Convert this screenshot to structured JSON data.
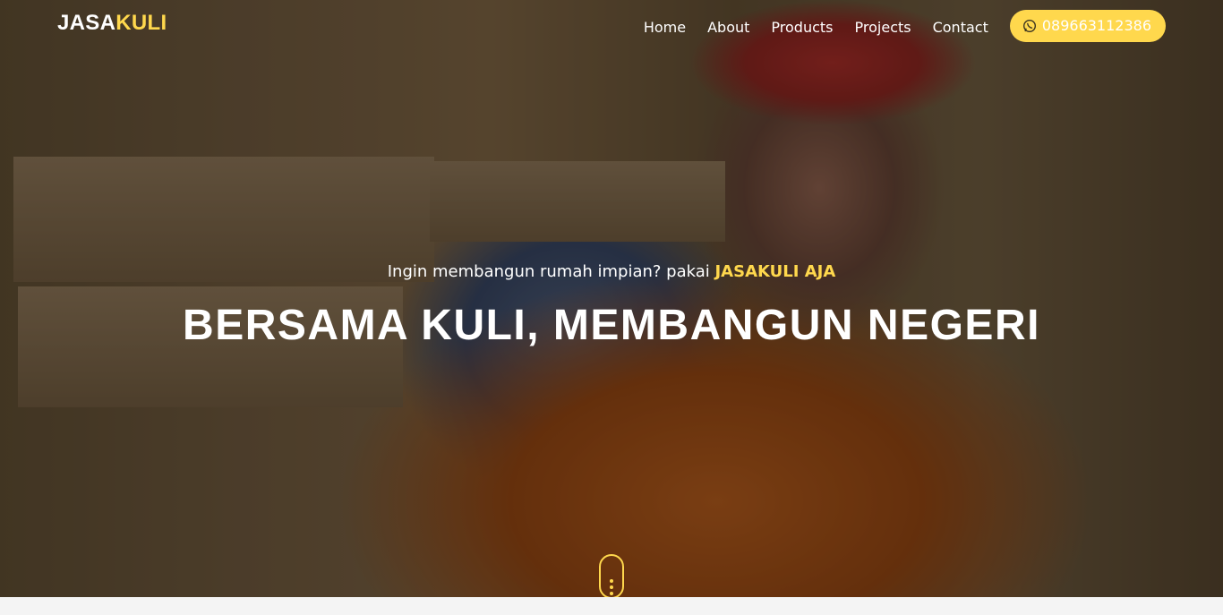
{
  "brand": {
    "part1": "JASA",
    "part2": "KULI"
  },
  "nav": {
    "items": [
      {
        "label": "Home"
      },
      {
        "label": "About"
      },
      {
        "label": "Products"
      },
      {
        "label": "Projects"
      },
      {
        "label": "Contact"
      }
    ],
    "phone": {
      "icon": "whatsapp-icon",
      "number": "089663112386"
    }
  },
  "hero": {
    "tagline_prefix": "Ingin membangun rumah impian? pakai ",
    "tagline_highlight": "JASAKULI AJA",
    "headline": "BERSAMA KULI, MEMBANGUN NEGERI",
    "background_image": "construction worker in red hard hat carrying wooden planks"
  },
  "colors": {
    "accent": "#ffd84d",
    "text": "#ffffff"
  }
}
